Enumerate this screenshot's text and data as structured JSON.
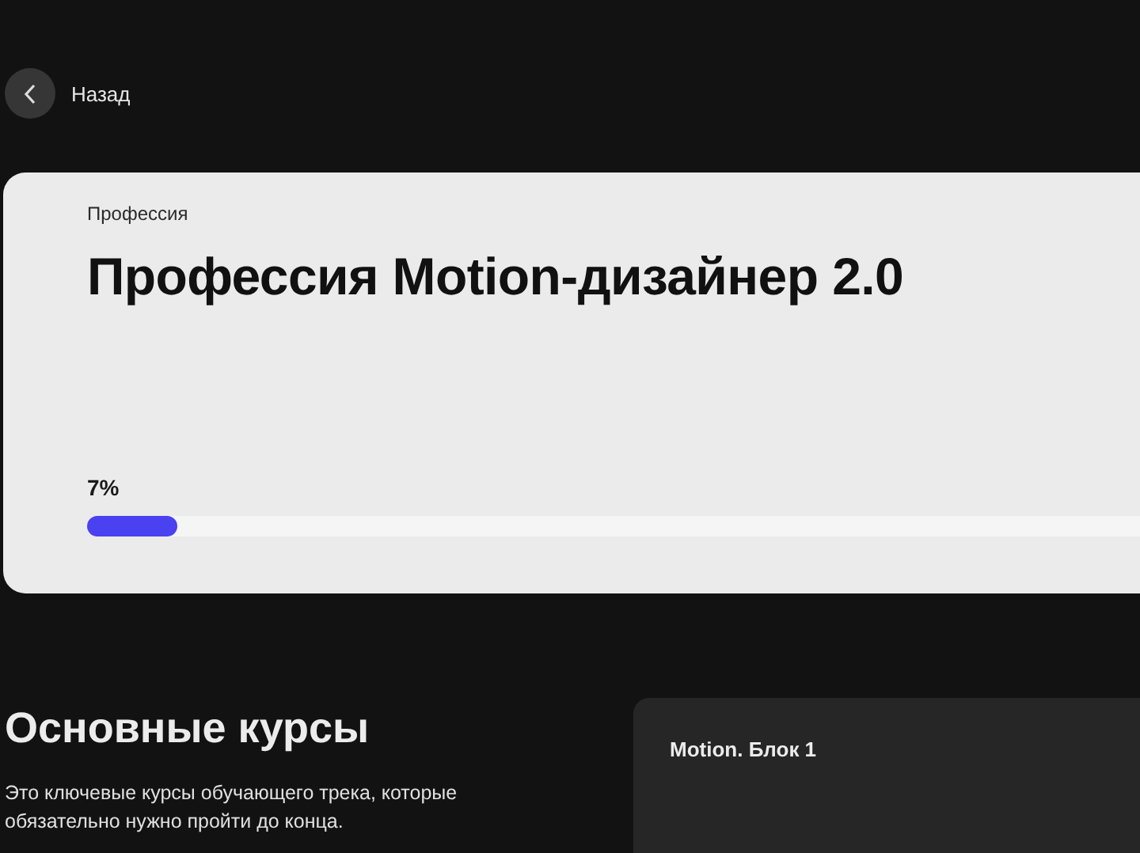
{
  "back": {
    "label": "Назад"
  },
  "profession": {
    "eyebrow": "Профессия",
    "title": "Профессия Motion-дизайнер 2.0",
    "progress": {
      "reading": "7%",
      "level": 0.07
    }
  },
  "main_courses": {
    "heading": "Основные курсы",
    "description": "Это ключевые курсы обучающего трека, которые обязательно нужно пройти до конца.",
    "cards": [
      {
        "title": "Motion. Блок 1"
      }
    ]
  }
}
